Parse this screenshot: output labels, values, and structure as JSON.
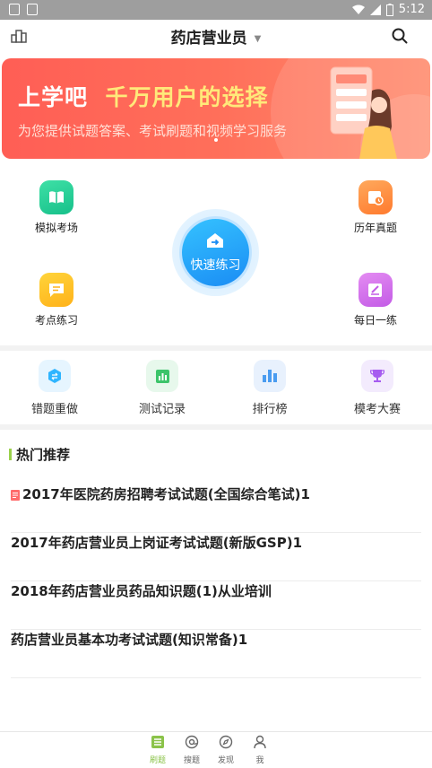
{
  "status_bar": {
    "time": "5:12"
  },
  "header": {
    "title": "药店营业员"
  },
  "banner": {
    "headline_part1": "上学吧",
    "headline_part2": "千万用户的选择",
    "subtitle": "为您提供试题答案、考试刷题和视频学习服务"
  },
  "features": {
    "mock_exam": "模拟考场",
    "past_papers": "历年真题",
    "point_practice": "考点练习",
    "daily_practice": "每日一练",
    "quick_practice": "快速练习"
  },
  "tools": [
    {
      "label": "错题重做",
      "color": "#2fb5ff",
      "icon": "redo-icon"
    },
    {
      "label": "测试记录",
      "color": "#3cc46a",
      "icon": "record-icon"
    },
    {
      "label": "排行榜",
      "color": "#4a9cf0",
      "icon": "ranking-icon"
    },
    {
      "label": "模考大赛",
      "color": "#a65cf0",
      "icon": "trophy-icon"
    }
  ],
  "hot": {
    "title": "热门推荐",
    "items": [
      "2017年医院药房招聘考试试题(全国综合笔试)1",
      "2017年药店营业员上岗证考试试题(新版GSP)1",
      "2018年药店营业员药品知识题(1)从业培训",
      "药店营业员基本功考试试题(知识常备)1"
    ]
  },
  "bottom_nav": [
    {
      "label": "刷题",
      "active": true
    },
    {
      "label": "搜题",
      "active": false
    },
    {
      "label": "发现",
      "active": false
    },
    {
      "label": "我",
      "active": false
    }
  ],
  "colors": {
    "accent": "#8bc34a",
    "banner": "#ff5e55",
    "primary_blue": "#1a8cf4"
  }
}
